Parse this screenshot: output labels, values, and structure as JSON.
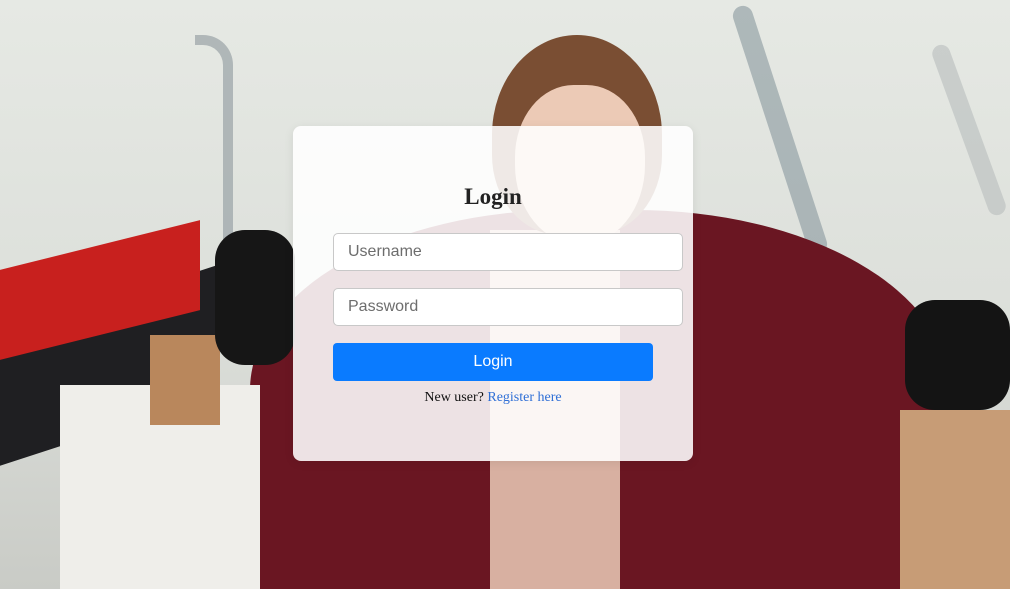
{
  "login": {
    "title": "Login",
    "username_placeholder": "Username",
    "password_placeholder": "Password",
    "submit_label": "Login",
    "new_user_text": "New user?",
    "register_link": "Register here"
  },
  "colors": {
    "button": "#0a7bff",
    "link": "#2f6fd6"
  }
}
